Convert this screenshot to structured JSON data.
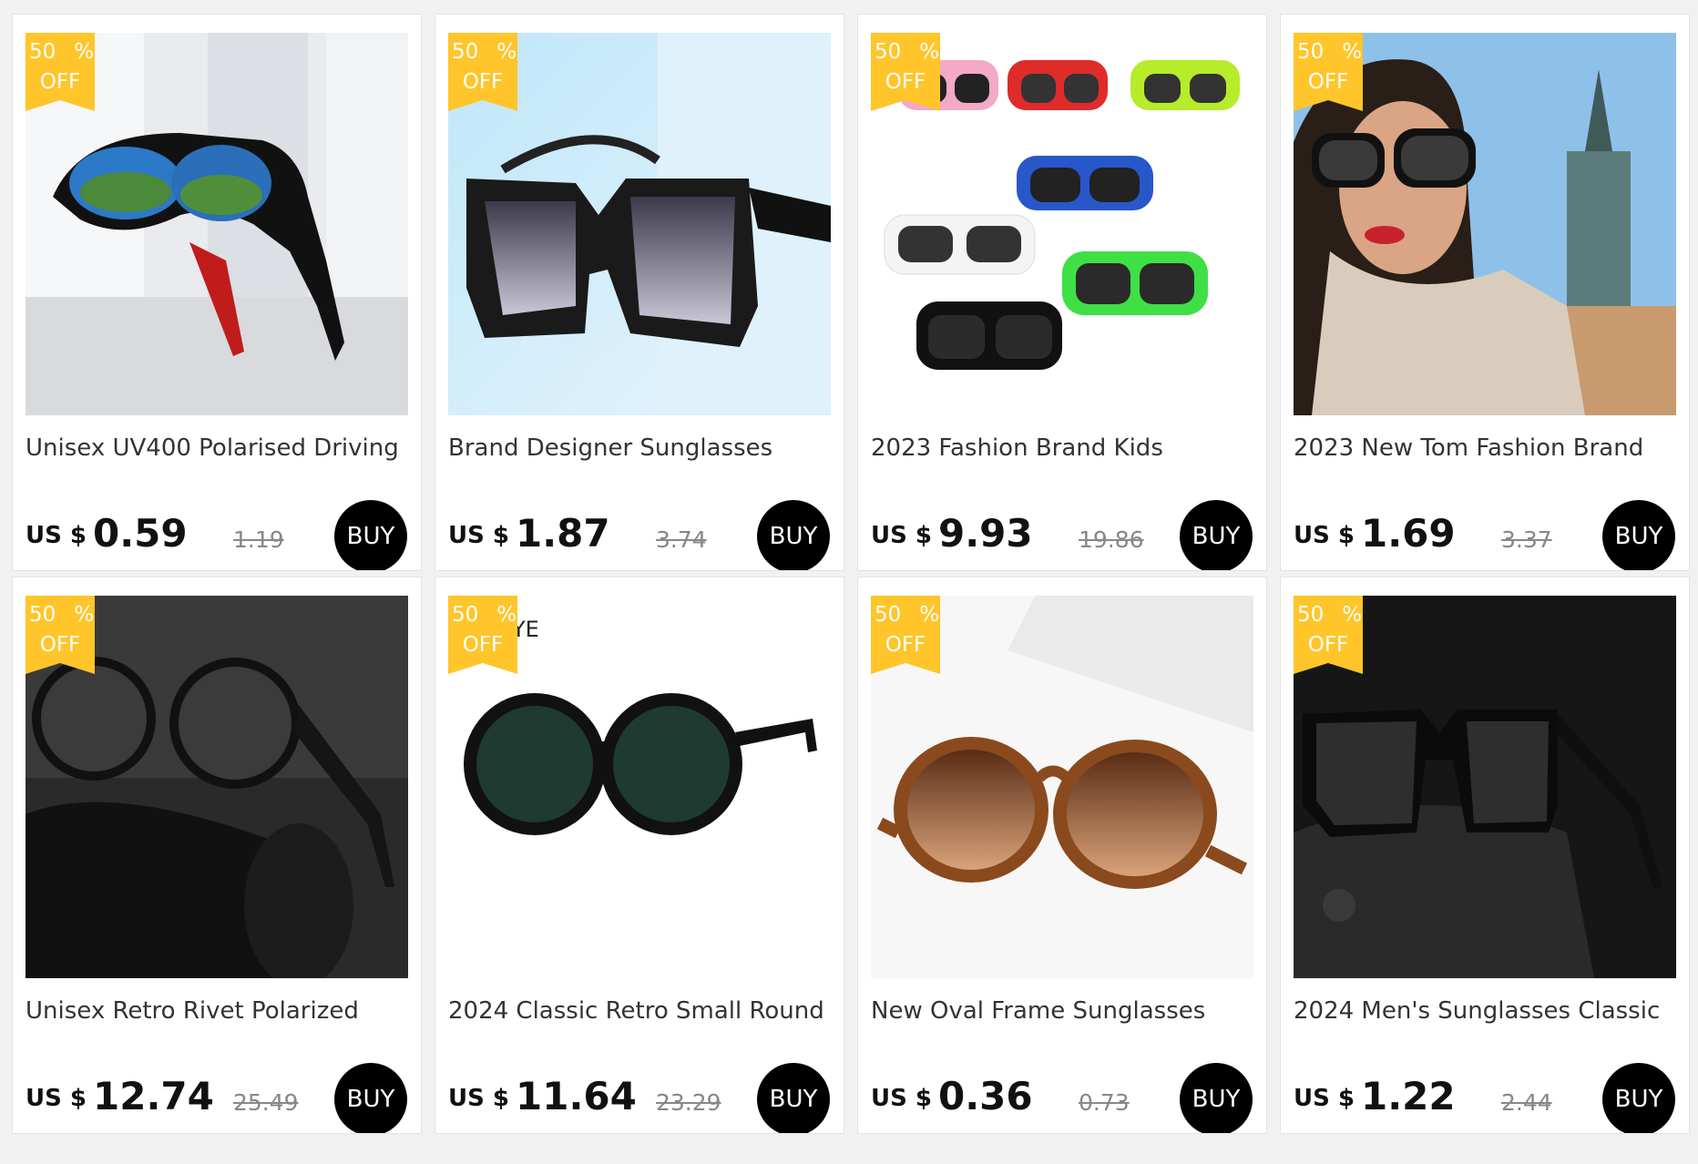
{
  "badge": {
    "percent": "50",
    "percent_sign": "%",
    "off": "OFF"
  },
  "currency": "US $",
  "buy_label": "BUY",
  "products": [
    {
      "title": "Unisex UV400 Polarised Driving",
      "price": "0.59",
      "old_price": "1.19"
    },
    {
      "title": "Brand Designer Sunglasses",
      "price": "1.87",
      "old_price": "3.74"
    },
    {
      "title": "2023 Fashion Brand Kids",
      "price": "9.93",
      "old_price": "19.86"
    },
    {
      "title": "2023 New Tom Fashion Brand",
      "price": "1.69",
      "old_price": "3.37"
    },
    {
      "title": "Unisex Retro Rivet Polarized",
      "price": "12.74",
      "old_price": "25.49"
    },
    {
      "title": "2024 Classic Retro Small Round",
      "price": "11.64",
      "old_price": "23.29",
      "image_text": "YE"
    },
    {
      "title": "New Oval Frame Sunglasses",
      "price": "0.36",
      "old_price": "0.73"
    },
    {
      "title": "2024 Men's Sunglasses Classic",
      "price": "1.22",
      "old_price": "2.44"
    }
  ]
}
